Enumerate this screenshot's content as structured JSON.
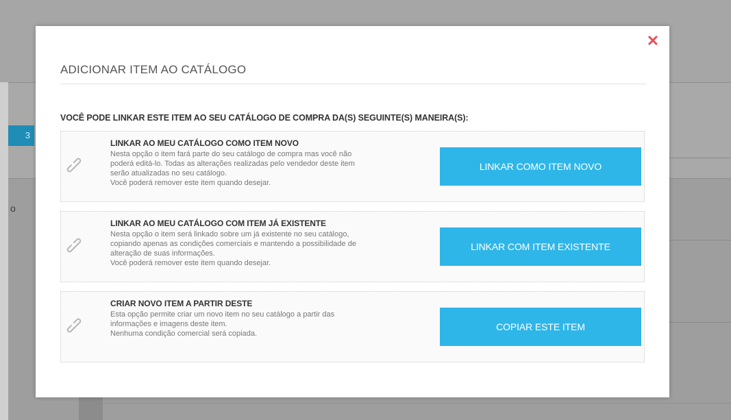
{
  "background": {
    "badge_text": "3",
    "side_letter": "o"
  },
  "modal": {
    "title": "ADICIONAR ITEM AO CATÁLOGO",
    "close_symbol": "✕",
    "instruction": "VOCÊ PODE LINKAR ESTE ITEM AO SEU CATÁLOGO DE COMPRA DA(S) SEGUINTE(S) MANEIRA(S):",
    "options": [
      {
        "heading": "LINKAR AO MEU CATÁLOGO COMO ITEM NOVO",
        "lines": [
          "Nesta opção o item fará parte do seu catálogo de compra mas você não",
          "poderá editá-lo. Todas as alterações realizadas pelo vendedor deste item",
          "serão atualizadas no seu catálogo.",
          "Você poderá remover este item quando desejar."
        ],
        "button_label": "LINKAR COMO ITEM NOVO",
        "icon": "link-icon"
      },
      {
        "heading": "LINKAR AO MEU CATÁLOGO COM ITEM JÁ EXISTENTE",
        "lines": [
          "Nesta opção o item será linkado sobre um já existente no seu catálogo,",
          "copiando apenas as condições comerciais e mantendo a possibilidade de",
          "alteração de suas informações.",
          "Você poderá remover este item quando desejar."
        ],
        "button_label": "LINKAR COM ITEM EXISTENTE",
        "icon": "link-icon"
      },
      {
        "heading": "CRIAR NOVO ITEM A PARTIR DESTE",
        "lines": [
          "Esta opção permite criar um novo item no seu catálogo a partir das",
          "informações e imagens deste item.",
          "Nenhuma condição comercial será copiada."
        ],
        "button_label": "COPIAR ESTE ITEM",
        "icon": "link-icon"
      }
    ]
  },
  "colors": {
    "accent": "#2fb6e8",
    "close": "#e8505b",
    "overlay": "#a6a6a6"
  }
}
